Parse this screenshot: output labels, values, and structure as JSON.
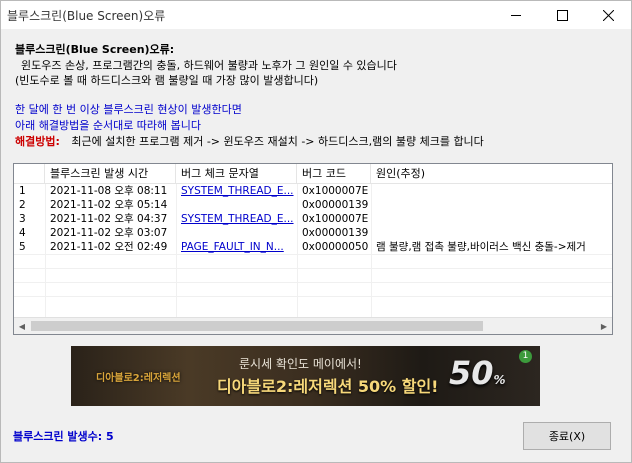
{
  "window": {
    "title": "블루스크린(Blue Screen)오류"
  },
  "messages": {
    "heading": "블루스크린(Blue Screen)오류:",
    "line1": "윈도우즈 손상, 프로그램간의 충돌, 하드웨어 불량과 노후가 그 원인일 수 있습니다",
    "line2": "(빈도수로 볼 때 하드디스크와 램 불량일 때 가장 많이 발생합니다)",
    "advice1": "한 달에 한 번 이상 블루스크린 현상이 발생한다면",
    "advice2": "아래 해결방법을 순서대로 따라해 봅니다",
    "solution_label": "해결방법:",
    "solution_text": "최근에 설치한 프로그램 제거 -> 윈도우즈 재설치 -> 하드디스크,램의 불량 체크를 합니다"
  },
  "table": {
    "columns": [
      "",
      "블루스크린 발생 시간",
      "버그 체크 문자열",
      "버그 코드",
      "원인(추정)"
    ],
    "rows": [
      {
        "num": "1",
        "time": "2021-11-08 오후 08:11",
        "bug_string": "SYSTEM_THREAD_E...",
        "code": "0x1000007E",
        "cause": ""
      },
      {
        "num": "2",
        "time": "2021-11-02 오후 05:14",
        "bug_string": "",
        "code": "0x00000139",
        "cause": ""
      },
      {
        "num": "3",
        "time": "2021-11-02 오후 04:37",
        "bug_string": "SYSTEM_THREAD_E...",
        "code": "0x1000007E",
        "cause": ""
      },
      {
        "num": "4",
        "time": "2021-11-02 오후 03:07",
        "bug_string": "",
        "code": "0x00000139",
        "cause": ""
      },
      {
        "num": "5",
        "time": "2021-11-02 오전 02:49",
        "bug_string": "PAGE_FAULT_IN_N...",
        "code": "0x00000050",
        "cause": "램 불량,램 접촉 불량,바이러스 백신 충돌->제거"
      }
    ]
  },
  "banner": {
    "logo_text": "디아블로2:레저렉션",
    "line1": "룬시세 확인도 메이에서!",
    "line2": "디아블로2:레저렉션 50% 할인!",
    "percent": "50",
    "percent_sign": "%",
    "badge": "1"
  },
  "footer": {
    "count_label": "블루스크린 발생수: 5",
    "close_label": "종료(X)"
  },
  "colors": {
    "link": "#0000cc",
    "solution_label": "#cc0000",
    "window_bg": "#f0f0f0"
  }
}
